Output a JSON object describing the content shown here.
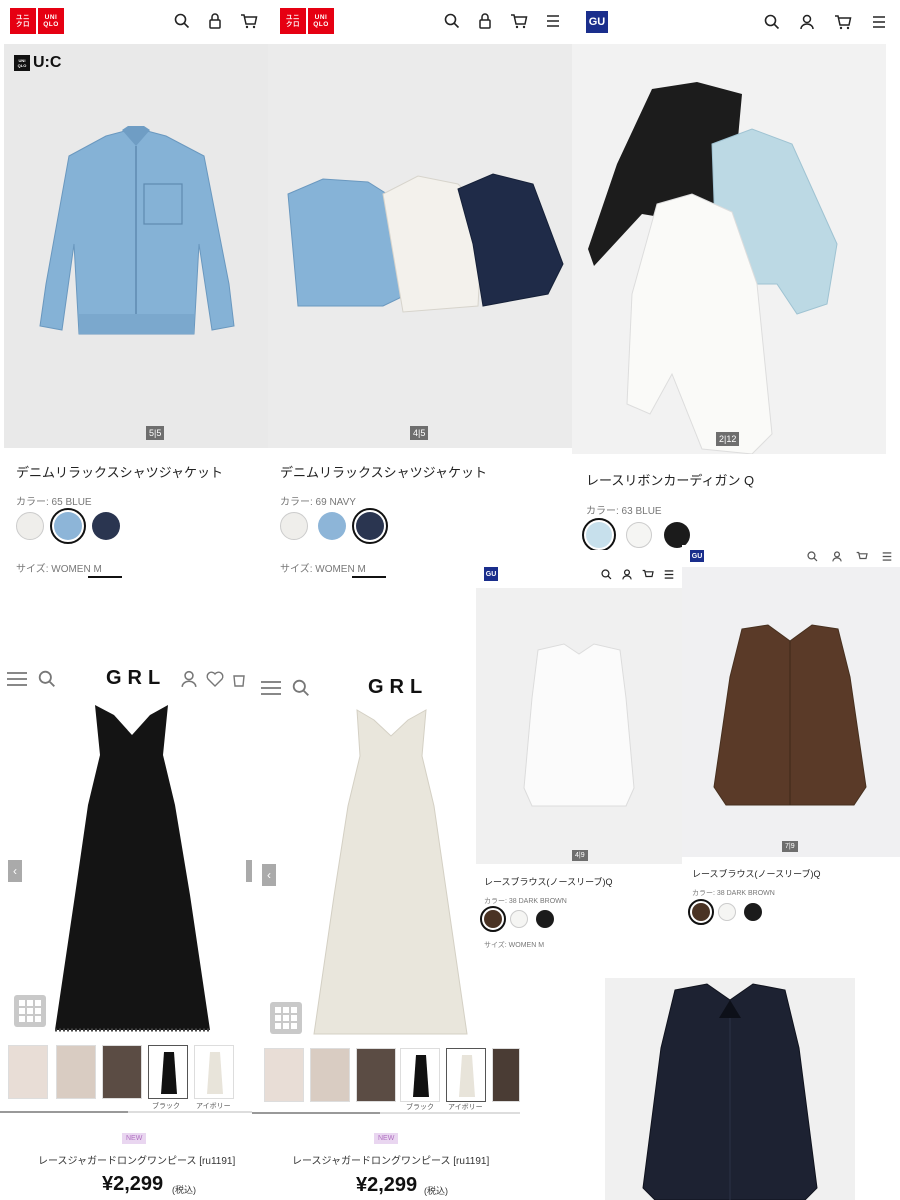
{
  "panel_uq1": {
    "brand": "UNIQLO",
    "sub_brand": "U:C",
    "counter": "5|5",
    "product_name": "デニムリラックスシャツジャケット",
    "color_label": "カラー: 65 BLUE",
    "size_label": "サイズ: WOMEN M",
    "swatches": [
      "#efeeeb",
      "#8db5d8",
      "#2a3550"
    ],
    "selected_swatch": 1
  },
  "panel_uq2": {
    "brand": "UNIQLO",
    "counter": "4|5",
    "product_name": "デニムリラックスシャツジャケット",
    "color_label": "カラー: 69 NAVY",
    "size_label": "サイズ: WOMEN M",
    "swatches": [
      "#efeeeb",
      "#8db5d8",
      "#2a3550"
    ],
    "selected_swatch": 2
  },
  "panel_gu1": {
    "brand": "GU",
    "counter": "2|12",
    "product_name": "レースリボンカーディガン Q",
    "color_label": "カラー: 63 BLUE",
    "swatches": [
      "#c7e0ec",
      "#f5f5f3",
      "#1b1b1b"
    ],
    "selected_swatch": 0
  },
  "panel_grl1": {
    "brand": "GRL",
    "thumb_labels": [
      "ブラック",
      "アイボリー"
    ],
    "badge": "NEW",
    "product_name": "レースジャガードロングワンピース [ru1191]",
    "price": "¥2,299",
    "tax": "(税込)"
  },
  "panel_grl2": {
    "brand": "GRL",
    "thumb_labels": [
      "ブラック",
      "アイボリー"
    ],
    "badge": "NEW",
    "product_name": "レースジャガードロングワンピース [ru1191]",
    "price": "¥2,299",
    "tax": "(税込)"
  },
  "panel_gu2": {
    "brand": "GU",
    "counter": "4|9",
    "product_name": "レースブラウス(ノースリーブ)Q",
    "color_label": "カラー: 38 DARK BROWN",
    "size_label": "サイズ: WOMEN M",
    "swatches": [
      "#4a3324",
      "#f5f5f3",
      "#1b1b1b"
    ],
    "selected_swatch": 0
  },
  "panel_gu3": {
    "brand": "GU",
    "counter": "7|9",
    "product_name": "レースブラウス(ノースリーブ)Q",
    "color_label": "カラー: 38 DARK BROWN",
    "swatches": [
      "#4a3324",
      "#f5f5f3",
      "#1b1b1b"
    ],
    "selected_swatch": 0
  },
  "colors": {
    "uniqlo_red": "#e60012",
    "gu_blue": "#1a2e8c",
    "denim_light": "#7eaed3",
    "navy": "#1e2a45",
    "brown": "#5a3a28"
  }
}
